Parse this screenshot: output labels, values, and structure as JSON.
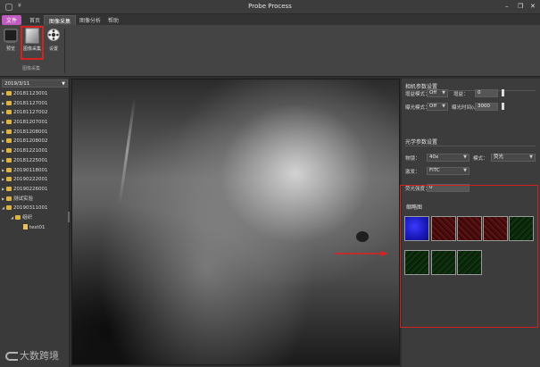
{
  "window": {
    "title": "Probe Process",
    "quick_access": "¥",
    "minimize": "–",
    "restore": "❐",
    "close": "✕"
  },
  "ribbon_tabs": [
    {
      "label": "文件"
    },
    {
      "label": "首页"
    },
    {
      "label": "图像采集"
    },
    {
      "label": "图像分析"
    },
    {
      "label": "帮助"
    }
  ],
  "ribbon_buttons": [
    {
      "label": "预览",
      "icon": "preview-camera-icon"
    },
    {
      "label": "图像采集",
      "icon": "capture-image-icon"
    },
    {
      "label": "设置",
      "icon": "settings-gear-icon"
    }
  ],
  "ribbon_group_caption": "图像采集",
  "left_panel": {
    "date": "2019/3/11",
    "tree": [
      {
        "label": "20181123001"
      },
      {
        "label": "20181127001"
      },
      {
        "label": "20181127002"
      },
      {
        "label": "20181207001"
      },
      {
        "label": "20181208001"
      },
      {
        "label": "20181208002"
      },
      {
        "label": "20181221001"
      },
      {
        "label": "20181225001"
      },
      {
        "label": "20190118001"
      },
      {
        "label": "20190222001"
      },
      {
        "label": "20190226001"
      },
      {
        "label": "测试实验"
      },
      {
        "label": "20190311001"
      },
      {
        "label": "组织"
      },
      {
        "label": "test01"
      }
    ]
  },
  "right_panel": {
    "camera_section": "相机参数设置",
    "gain_mode_label": "增益模式：",
    "gain_mode_value": "Off",
    "gain_label": "增益：",
    "gain_value": "0",
    "exposure_mode_label": "曝光模式：",
    "exposure_mode_value": "Off",
    "exposure_time_label": "曝光时间(us)：",
    "exposure_time_value": "3000",
    "optics_section": "光学参数设置",
    "objective_label": "物镜：",
    "objective_value": "40x",
    "mode_label": "模式：",
    "mode_value": "荧光",
    "filter_label": "激发：",
    "filter_value": "FITC",
    "zstack_label": "荧光强度：",
    "zstack_value": "0",
    "thumbnails_title": "缩略图",
    "thumbnails": [
      {
        "color": "blue"
      },
      {
        "color": "red"
      },
      {
        "color": "red"
      },
      {
        "color": "red"
      },
      {
        "color": "green"
      },
      {
        "color": "green"
      },
      {
        "color": "green"
      },
      {
        "color": "green"
      }
    ]
  },
  "watermark": "大数跨境",
  "colors": {
    "highlight_red": "#d42222",
    "file_tab": "#c05cc0"
  }
}
